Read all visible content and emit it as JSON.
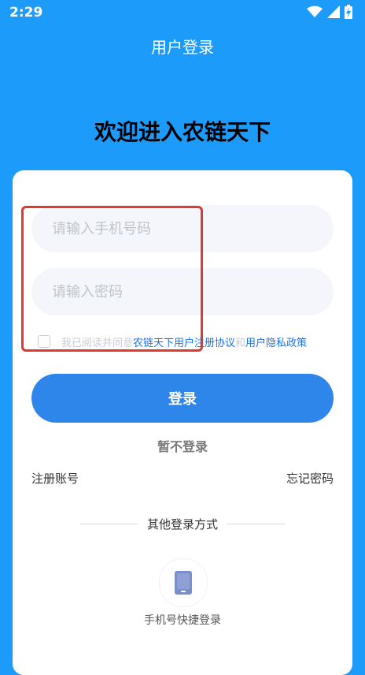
{
  "status_bar": {
    "time": "2:29"
  },
  "header": {
    "title": "用户登录"
  },
  "welcome": {
    "text": "欢迎进入农链天下"
  },
  "form": {
    "phone_placeholder": "请输入手机号码",
    "password_placeholder": "请输入密码",
    "agree_prefix": "我已阅读并同意",
    "agree_link1": "农链天下用户注册协议",
    "agree_and": "和",
    "agree_link2": "用户隐私政策",
    "login_button": "登录",
    "skip_login": "暂不登录",
    "register": "注册账号",
    "forgot_password": "忘记密码",
    "other_methods": "其他登录方式",
    "phone_quick_login": "手机号快捷登录"
  },
  "colors": {
    "background": "#1d9bfb",
    "button": "#2f86ea",
    "link": "#1a73e8",
    "highlight": "#e03a2e"
  },
  "icons": [
    "wifi-icon",
    "signal-icon",
    "battery-icon",
    "phone-device-icon"
  ]
}
